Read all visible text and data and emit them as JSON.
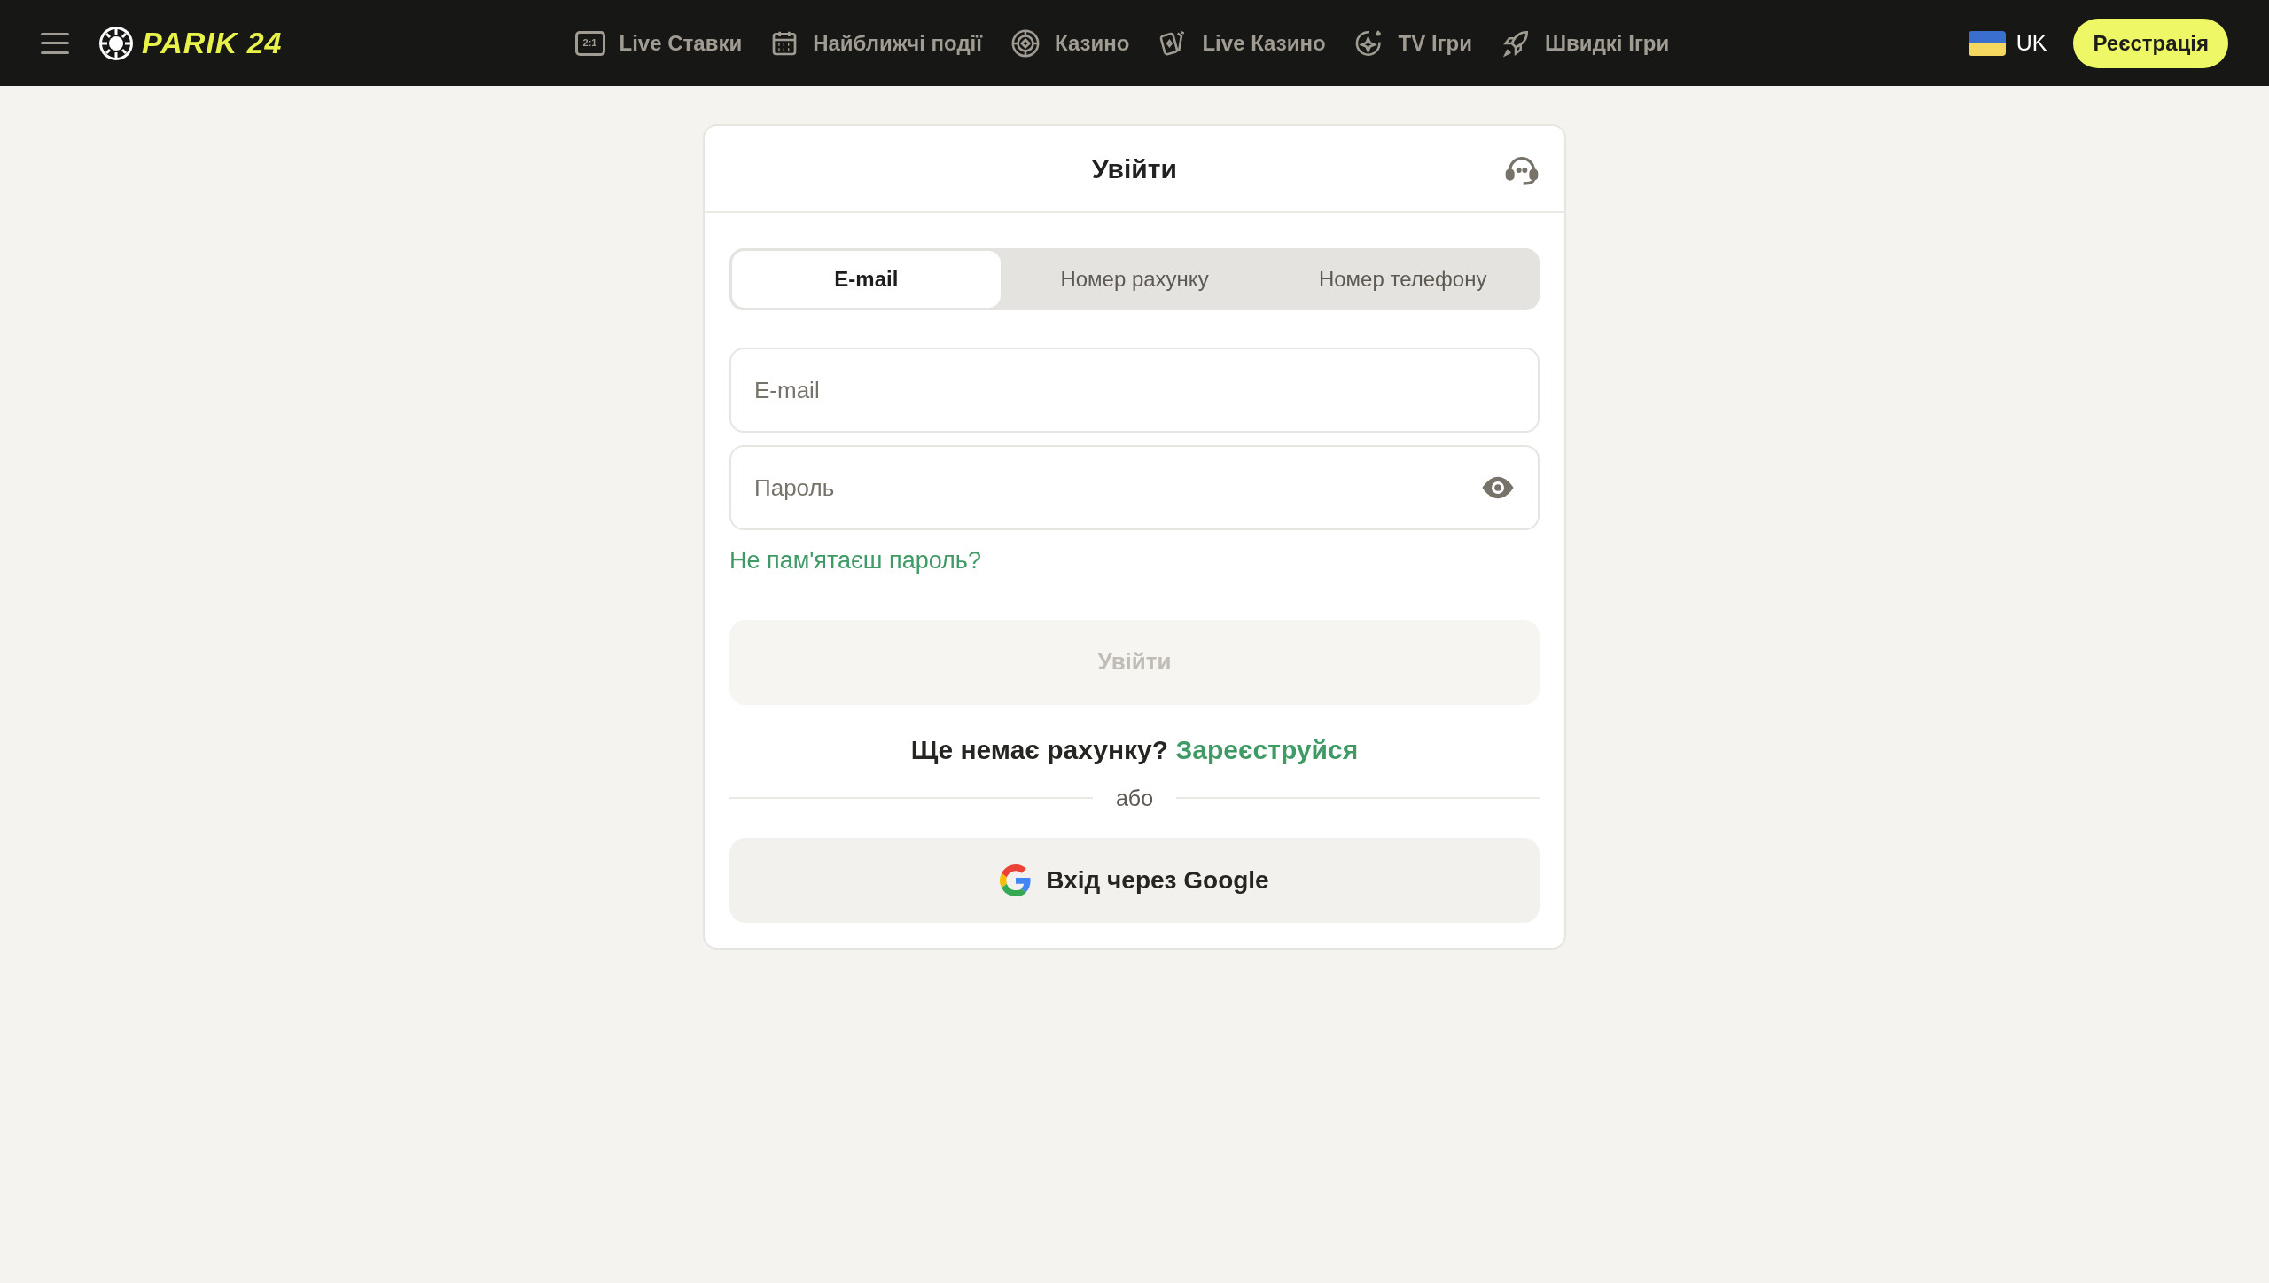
{
  "header": {
    "logo": "PARIK 24",
    "nav": [
      {
        "kind": "odds",
        "badge": "2:1",
        "label": "Live Ставки"
      },
      {
        "kind": "calendar",
        "label": "Найближчі події"
      },
      {
        "kind": "chip",
        "label": "Казино"
      },
      {
        "kind": "cards",
        "label": "Live Казино"
      },
      {
        "kind": "sparkle",
        "label": "TV Ігри"
      },
      {
        "kind": "rocket",
        "label": "Швидкі Ігри"
      }
    ],
    "language": "UK",
    "register": "Реєстрація"
  },
  "login": {
    "title": "Увійти",
    "tabs": [
      {
        "label": "E-mail",
        "selected": true
      },
      {
        "label": "Номер рахунку",
        "selected": false
      },
      {
        "label": "Номер телефону",
        "selected": false
      }
    ],
    "email": {
      "placeholder": "E-mail"
    },
    "password": {
      "placeholder": "Пароль"
    },
    "forgot": "Не пам'ятаєш пароль?",
    "submit": {
      "label": "Увійти",
      "disabled": true
    },
    "no_account": "Ще немає рахунку?",
    "signup": "Зареєструйся",
    "or": "або",
    "google": "Вхід через Google"
  }
}
